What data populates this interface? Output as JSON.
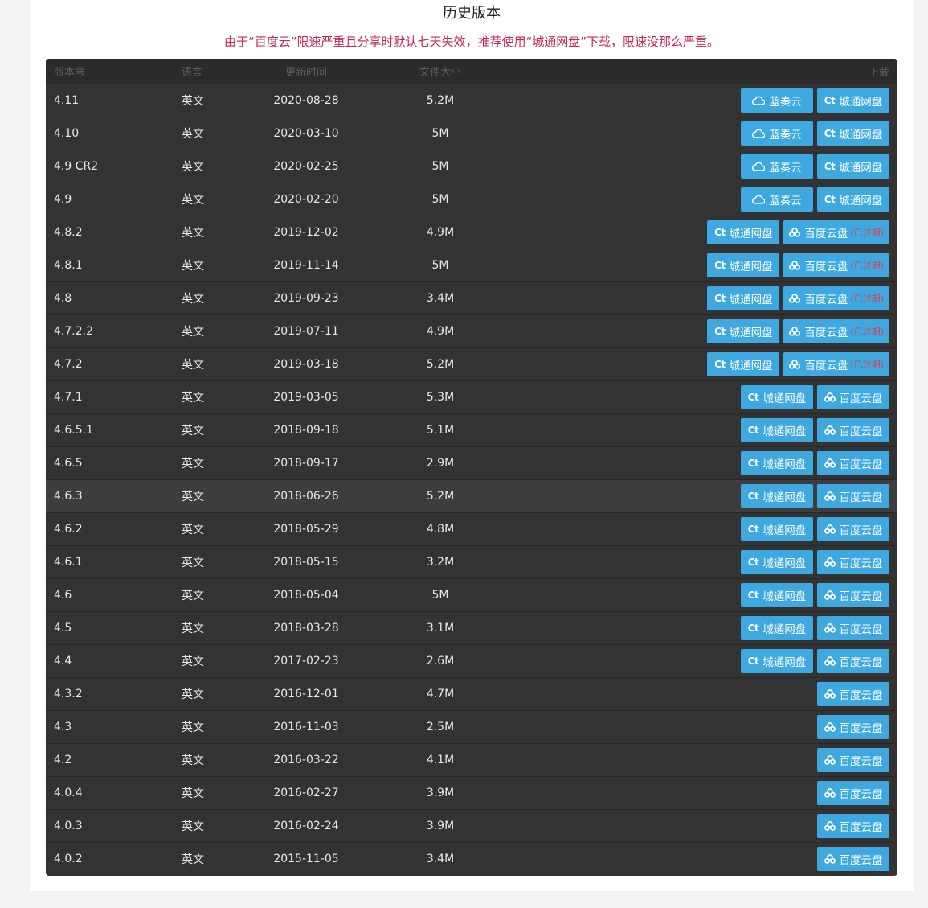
{
  "page": {
    "title": "历史版本",
    "notice": "由于“百度云”限速严重且分享时默认七天失效，推荐使用“城通网盘”下载，限速没那么严重。"
  },
  "colors": {
    "button": "#3ea9e0",
    "notice": "#c7254e",
    "table_bg": "#333333",
    "expired": "#e8364a"
  },
  "table": {
    "headers": {
      "version": "版本号",
      "language": "语言",
      "date": "更新时间",
      "size": "文件大小",
      "download": "下载"
    },
    "labels": {
      "lanzou": "蓝奏云",
      "ctfile": "城通网盘",
      "baidu": "百度云盘",
      "expired": "(已过期)"
    },
    "icons": {
      "lanzou": "cloud-icon",
      "ctfile": "ct-logo-icon",
      "baidu": "baidu-cloud-icon"
    },
    "rows": [
      {
        "version": "4.11",
        "language": "英文",
        "date": "2020-08-28",
        "size": "5.2M",
        "links": [
          "lanzou",
          "ctfile"
        ]
      },
      {
        "version": "4.10",
        "language": "英文",
        "date": "2020-03-10",
        "size": "5M",
        "links": [
          "lanzou",
          "ctfile"
        ]
      },
      {
        "version": "4.9 CR2",
        "language": "英文",
        "date": "2020-02-25",
        "size": "5M",
        "links": [
          "lanzou",
          "ctfile"
        ]
      },
      {
        "version": "4.9",
        "language": "英文",
        "date": "2020-02-20",
        "size": "5M",
        "links": [
          "lanzou",
          "ctfile"
        ]
      },
      {
        "version": "4.8.2",
        "language": "英文",
        "date": "2019-12-02",
        "size": "4.9M",
        "links": [
          "ctfile",
          "baidu-expired"
        ]
      },
      {
        "version": "4.8.1",
        "language": "英文",
        "date": "2019-11-14",
        "size": "5M",
        "links": [
          "ctfile",
          "baidu-expired"
        ]
      },
      {
        "version": "4.8",
        "language": "英文",
        "date": "2019-09-23",
        "size": "3.4M",
        "links": [
          "ctfile",
          "baidu-expired"
        ]
      },
      {
        "version": "4.7.2.2",
        "language": "英文",
        "date": "2019-07-11",
        "size": "4.9M",
        "links": [
          "ctfile",
          "baidu-expired"
        ]
      },
      {
        "version": "4.7.2",
        "language": "英文",
        "date": "2019-03-18",
        "size": "5.2M",
        "links": [
          "ctfile",
          "baidu-expired"
        ]
      },
      {
        "version": "4.7.1",
        "language": "英文",
        "date": "2019-03-05",
        "size": "5.3M",
        "links": [
          "ctfile",
          "baidu"
        ]
      },
      {
        "version": "4.6.5.1",
        "language": "英文",
        "date": "2018-09-18",
        "size": "5.1M",
        "links": [
          "ctfile",
          "baidu"
        ]
      },
      {
        "version": "4.6.5",
        "language": "英文",
        "date": "2018-09-17",
        "size": "2.9M",
        "links": [
          "ctfile",
          "baidu"
        ]
      },
      {
        "version": "4.6.3",
        "language": "英文",
        "date": "2018-06-26",
        "size": "5.2M",
        "links": [
          "ctfile",
          "baidu"
        ],
        "highlighted": true
      },
      {
        "version": "4.6.2",
        "language": "英文",
        "date": "2018-05-29",
        "size": "4.8M",
        "links": [
          "ctfile",
          "baidu"
        ]
      },
      {
        "version": "4.6.1",
        "language": "英文",
        "date": "2018-05-15",
        "size": "3.2M",
        "links": [
          "ctfile",
          "baidu"
        ]
      },
      {
        "version": "4.6",
        "language": "英文",
        "date": "2018-05-04",
        "size": "5M",
        "links": [
          "ctfile",
          "baidu"
        ]
      },
      {
        "version": "4.5",
        "language": "英文",
        "date": "2018-03-28",
        "size": "3.1M",
        "links": [
          "ctfile",
          "baidu"
        ]
      },
      {
        "version": "4.4",
        "language": "英文",
        "date": "2017-02-23",
        "size": "2.6M",
        "links": [
          "ctfile",
          "baidu"
        ]
      },
      {
        "version": "4.3.2",
        "language": "英文",
        "date": "2016-12-01",
        "size": "4.7M",
        "links": [
          "baidu"
        ]
      },
      {
        "version": "4.3",
        "language": "英文",
        "date": "2016-11-03",
        "size": "2.5M",
        "links": [
          "baidu"
        ]
      },
      {
        "version": "4.2",
        "language": "英文",
        "date": "2016-03-22",
        "size": "4.1M",
        "links": [
          "baidu"
        ]
      },
      {
        "version": "4.0.4",
        "language": "英文",
        "date": "2016-02-27",
        "size": "3.9M",
        "links": [
          "baidu"
        ]
      },
      {
        "version": "4.0.3",
        "language": "英文",
        "date": "2016-02-24",
        "size": "3.9M",
        "links": [
          "baidu"
        ]
      },
      {
        "version": "4.0.2",
        "language": "英文",
        "date": "2015-11-05",
        "size": "3.4M",
        "links": [
          "baidu"
        ]
      }
    ]
  }
}
